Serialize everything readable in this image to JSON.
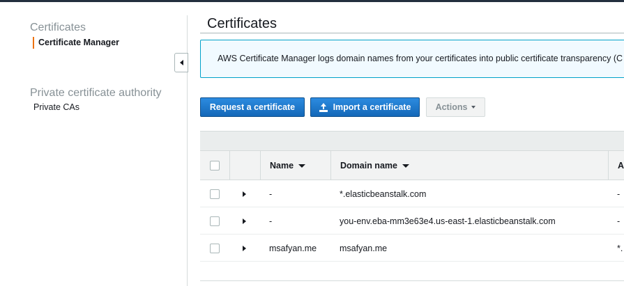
{
  "sidebar": {
    "section1_title": "Certificates",
    "section1_item": "Certificate Manager",
    "section2_title": "Private certificate authority",
    "section2_item": "Private CAs"
  },
  "main": {
    "title": "Certificates",
    "info_text": "AWS Certificate Manager logs domain names from your certificates into public certificate transparency (C",
    "buttons": {
      "request": "Request a certificate",
      "import": "Import a certificate",
      "actions": "Actions"
    },
    "table": {
      "columns": [
        "Name",
        "Domain name",
        "A"
      ],
      "rows": [
        {
          "name": "-",
          "domain": "*.elasticbeanstalk.com",
          "extra": "-"
        },
        {
          "name": "-",
          "domain": "you-env.eba-mm3e63e4.us-east-1.elasticbeanstalk.com",
          "extra": "-"
        },
        {
          "name": "msafyan.me",
          "domain": "msafyan.me",
          "extra": "*."
        }
      ]
    }
  },
  "colors": {
    "accent_orange": "#ec7211",
    "primary_blue": "#1a73c7",
    "info_border": "#00a1c9",
    "nav_dark": "#232f3e"
  },
  "icons": [
    "collapse-left-icon",
    "upload-icon",
    "caret-down-icon",
    "sort-down-icon",
    "expand-right-icon"
  ]
}
